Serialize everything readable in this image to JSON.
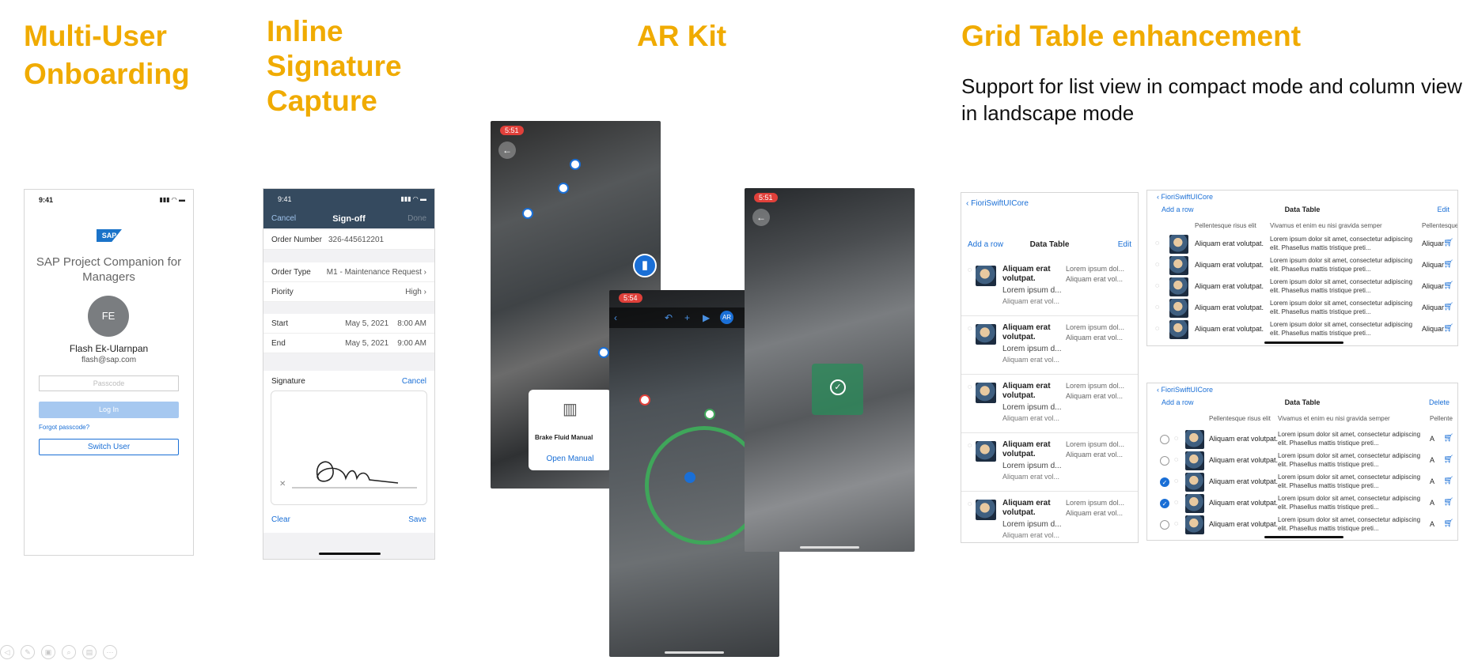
{
  "sections": {
    "onboarding_title": "Multi-User Onboarding",
    "signature_title": "Inline Signature Capture",
    "ar_title": "AR Kit",
    "grid_title": "Grid Table enhancement",
    "grid_subtitle": "Support for list view in compact mode and column view in landscape mode"
  },
  "onboarding": {
    "time": "9:41",
    "status_icons": "▮▮▮ ◠ ▬",
    "brand": "SAP",
    "app_name": "SAP Project Companion for Managers",
    "initials": "FE",
    "user_name": "Flash Ek-Ularnpan",
    "email": "flash@sap.com",
    "passcode_placeholder": "Passcode",
    "login_label": "Log In",
    "forgot_label": "Forgot passcode?",
    "switch_label": "Switch User"
  },
  "signature": {
    "time": "9:41",
    "status_icons": "▮▮▮ ◠ ▬",
    "cancel": "Cancel",
    "title": "Sign-off",
    "done": "Done",
    "order_number_label": "Order Number",
    "order_number": "326-445612201",
    "order_type_label": "Order Type",
    "order_type": "M1 - Maintenance Request",
    "priority_label": "Piority",
    "priority": "High",
    "start_label": "Start",
    "start_date": "May 5, 2021",
    "start_time": "8:00 AM",
    "end_label": "End",
    "end_date": "May 5, 2021",
    "end_time": "9:00 AM",
    "signature_label": "Signature",
    "signature_cancel": "Cancel",
    "clear": "Clear",
    "save": "Save"
  },
  "ar": {
    "time1": "5:51",
    "time2": "5:54",
    "time3": "5:51",
    "manual_name": "Brake Fluid Manual",
    "open_manual": "Open Manual",
    "ar_badge": "AR"
  },
  "grid_compact": {
    "back": "FioriSwiftUICore",
    "add_row": "Add a row",
    "title": "Data Table",
    "edit": "Edit",
    "rows": [
      {
        "title": "Aliquam erat volutpat.",
        "sub": "Lorem ipsum d...",
        "foot": "Aliquam erat vol...",
        "c2a": "Lorem ipsum dol...",
        "c2b": "Aliquam erat vol..."
      },
      {
        "title": "Aliquam erat volutpat.",
        "sub": "Lorem ipsum d...",
        "foot": "Aliquam erat vol...",
        "c2a": "Lorem ipsum dol...",
        "c2b": "Aliquam erat vol..."
      },
      {
        "title": "Aliquam erat volutpat.",
        "sub": "Lorem ipsum d...",
        "foot": "Aliquam erat vol...",
        "c2a": "Lorem ipsum dol...",
        "c2b": "Aliquam erat vol..."
      },
      {
        "title": "Aliquam erat volutpat.",
        "sub": "Lorem ipsum d...",
        "foot": "Aliquam erat vol...",
        "c2a": "Lorem ipsum dol...",
        "c2b": "Aliquam erat vol..."
      },
      {
        "title": "Aliquam erat volutpat.",
        "sub": "Lorem ipsum d...",
        "foot": "Aliquam erat vol...",
        "c2a": "Lorem ipsum dol...",
        "c2b": "Aliquam erat vol..."
      }
    ]
  },
  "grid_land1": {
    "back": "FioriSwiftUICore",
    "add_row": "Add a row",
    "title": "Data Table",
    "edit": "Edit",
    "col1": "Pellentesque risus elit",
    "col2": "Vivamus et enim eu nisi gravida semper",
    "col3": "Pellentesque",
    "row_a": "Aliquam erat volutpat.",
    "row_b": "Lorem ipsum dolor sit amet, consectetur adipiscing elit. Phasellus mattis tristique preti...",
    "row_c": "Aliquam"
  },
  "grid_land2": {
    "back": "FioriSwiftUICore",
    "add_row": "Add a row",
    "title": "Data Table",
    "delete": "Delete",
    "col1": "Pellentesque risus elit",
    "col2": "Vivamus et enim eu nisi gravida semper",
    "col3": "Pellente",
    "row_a": "Aliquam erat volutpat.",
    "row_b": "Lorem ipsum dolor sit amet, consectetur adipiscing elit. Phasellus mattis tristique preti...",
    "row_c": "A",
    "selected": [
      false,
      false,
      true,
      true,
      false
    ]
  },
  "colors": {
    "accent": "#f0ab00",
    "link": "#1a6fd6",
    "header": "#354a5f"
  }
}
